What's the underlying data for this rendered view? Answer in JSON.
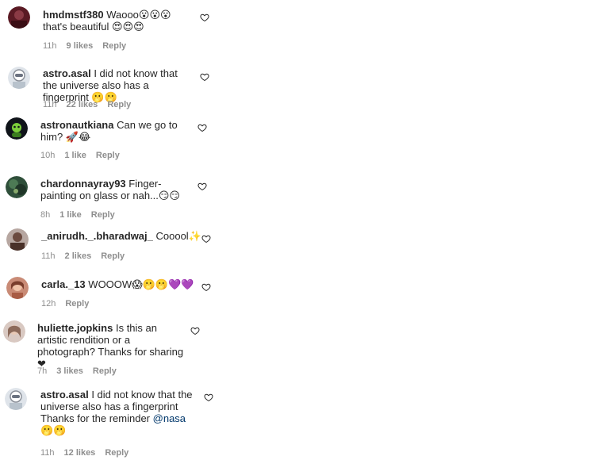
{
  "icons": {
    "like": "heart-outline-icon",
    "heart_emoji_color": "#c81d25",
    "purple_heart_color": "#8b2ddb"
  },
  "comments": [
    {
      "username": "hmdmstf380",
      "text": "Waooo😮😮😮that's beautiful 😍😍😍",
      "time": "11h",
      "likes": "9 likes",
      "reply": "Reply"
    },
    {
      "username": "astro.asal",
      "text": "I did not know that the universe also has a fingerprint 🫢🫢",
      "time": "11h",
      "likes": "22 likes",
      "reply": "Reply"
    },
    {
      "username": "astronautkiana",
      "text": "Can we go to him? 🚀😂",
      "time": "10h",
      "likes": "1 like",
      "reply": "Reply"
    },
    {
      "username": "chardonnayray93",
      "text": "Finger-painting on glass or nah...😏😏",
      "time": "8h",
      "likes": "1 like",
      "reply": "Reply"
    },
    {
      "username": "_anirudh._.bharadwaj_",
      "text": "Cooool✨",
      "time": "11h",
      "likes": "2 likes",
      "reply": "Reply"
    },
    {
      "username": "carla._13",
      "text": "WOOOW😱🫢🫢💜💜",
      "time": "12h",
      "likes": "",
      "reply": "Reply"
    },
    {
      "username": "huliette.jopkins",
      "text": "Is this an artistic rendition or a photograph? Thanks for sharing ❤",
      "time": "7h",
      "likes": "3 likes",
      "reply": "Reply"
    },
    {
      "username": "astro.asal",
      "text_before": "I did not know that the universe also has a fingerprint Thanks for the reminder",
      "mention": "@nasa",
      "text_after": "🫢🫢",
      "time": "11h",
      "likes": "12 likes",
      "reply": "Reply"
    }
  ]
}
